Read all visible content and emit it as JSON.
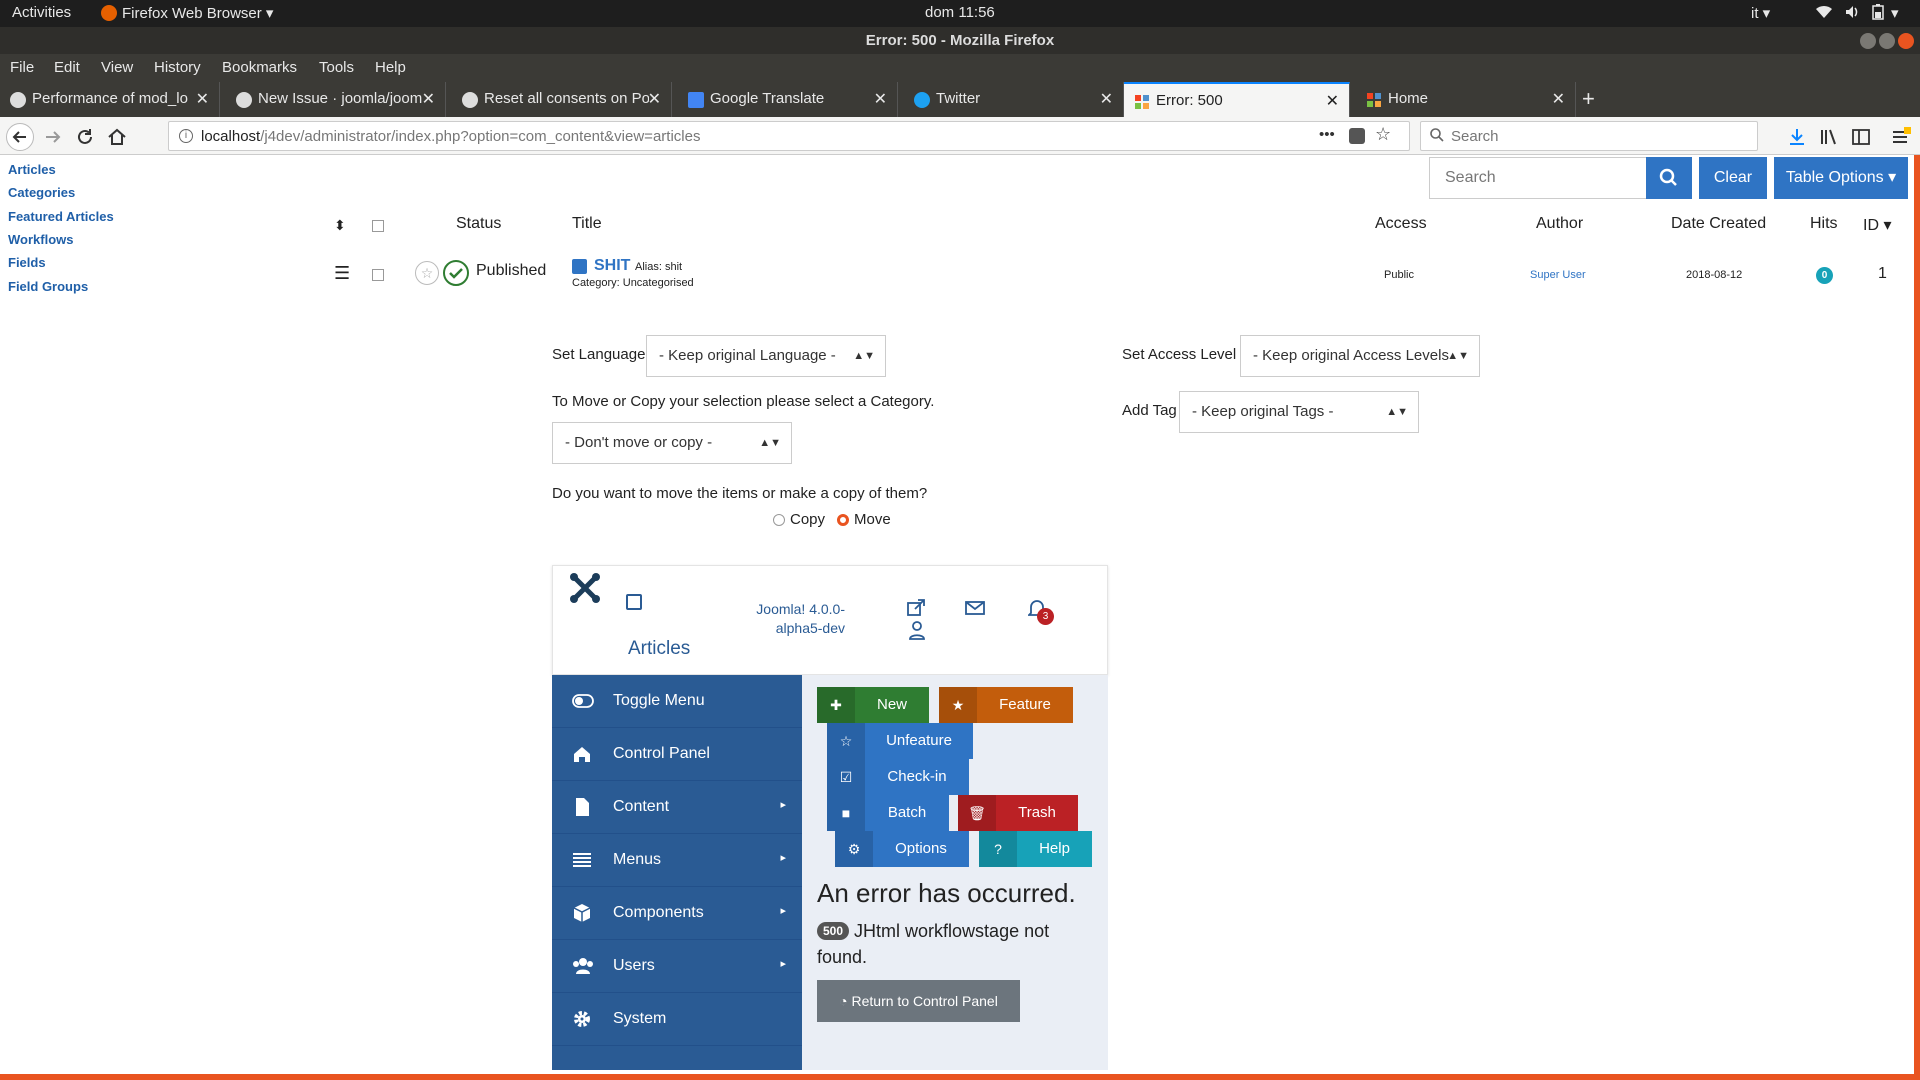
{
  "system": {
    "activities": "Activities",
    "app_name": "Firefox Web Browser",
    "clock": "dom 11:56",
    "lang": "it"
  },
  "window": {
    "title": "Error: 500 - Mozilla Firefox"
  },
  "menubar": [
    "File",
    "Edit",
    "View",
    "History",
    "Bookmarks",
    "Tools",
    "Help"
  ],
  "tabs": [
    {
      "label": "Performance of mod_lo",
      "icon": "github-icon"
    },
    {
      "label": "New Issue · joomla/joom",
      "icon": "github-icon"
    },
    {
      "label": "Reset all consents on Po",
      "icon": "github-icon"
    },
    {
      "label": "Google Translate",
      "icon": "google-translate-icon"
    },
    {
      "label": "Twitter",
      "icon": "twitter-icon"
    },
    {
      "label": "Error: 500",
      "icon": "joomla-icon",
      "active": true
    },
    {
      "label": "Home",
      "icon": "joomla-icon"
    }
  ],
  "url": {
    "host": "localhost",
    "path": "/j4dev/administrator/index.php?option=com_content&view=articles"
  },
  "browser_search": {
    "placeholder": "Search"
  },
  "sidebar_links": [
    "Articles",
    "Categories",
    "Featured Articles",
    "Workflows",
    "Fields",
    "Field Groups"
  ],
  "toolbar_top": {
    "search_placeholder": "Search",
    "clear": "Clear",
    "table_options": "Table Options"
  },
  "table": {
    "headers": {
      "status": "Status",
      "title": "Title",
      "access": "Access",
      "author": "Author",
      "date": "Date Created",
      "hits": "Hits",
      "id": "ID"
    },
    "row": {
      "status": "Published",
      "title": "SHIT",
      "alias": "Alias: shit",
      "category": "Category: Uncategorised",
      "access": "Public",
      "author": "Super User",
      "date": "2018-08-12",
      "hits": "0",
      "id": "1"
    }
  },
  "batch": {
    "set_language_label": "Set Language",
    "set_language_value": "- Keep original Language -",
    "move_copy_prompt": "To Move or Copy your selection please select a Category.",
    "category_value": "- Don't move or copy -",
    "move_or_copy_question": "Do you want to move the items or make a copy of them?",
    "copy_label": "Copy",
    "move_label": "Move",
    "access_label": "Set Access Level",
    "access_value": "- Keep original Access Levels",
    "tag_label": "Add Tag",
    "tag_value": "- Keep original Tags -"
  },
  "admin_header": {
    "page_title": "Articles",
    "version": "Joomla! 4.0.0-alpha5-dev",
    "notifications_count": "3"
  },
  "admin_sidebar": [
    {
      "label": "Toggle Menu",
      "icon": "toggle-icon",
      "submenu": false
    },
    {
      "label": "Control Panel",
      "icon": "home-icon",
      "submenu": false
    },
    {
      "label": "Content",
      "icon": "file-icon",
      "submenu": true
    },
    {
      "label": "Menus",
      "icon": "list-icon",
      "submenu": true
    },
    {
      "label": "Components",
      "icon": "cube-icon",
      "submenu": true
    },
    {
      "label": "Users",
      "icon": "users-icon",
      "submenu": true
    },
    {
      "label": "System",
      "icon": "cog-icon",
      "submenu": false
    }
  ],
  "toolbar_buttons": {
    "new": "New",
    "feature": "Feature",
    "unfeature": "Unfeature",
    "checkin": "Check-in",
    "batch": "Batch",
    "trash": "Trash",
    "options": "Options",
    "help": "Help"
  },
  "error": {
    "heading": "An error has occurred.",
    "code": "500",
    "message": "JHtml workflowstage not found.",
    "return_button": "Return to Control Panel"
  },
  "colors": {
    "joomla_blue": "#2a5b94",
    "new_green": "#2f7d32",
    "feature_orange": "#c35d0c",
    "trash_red": "#bb2125",
    "help_teal": "#17a2b8",
    "primary_blue": "#2f74c4"
  }
}
